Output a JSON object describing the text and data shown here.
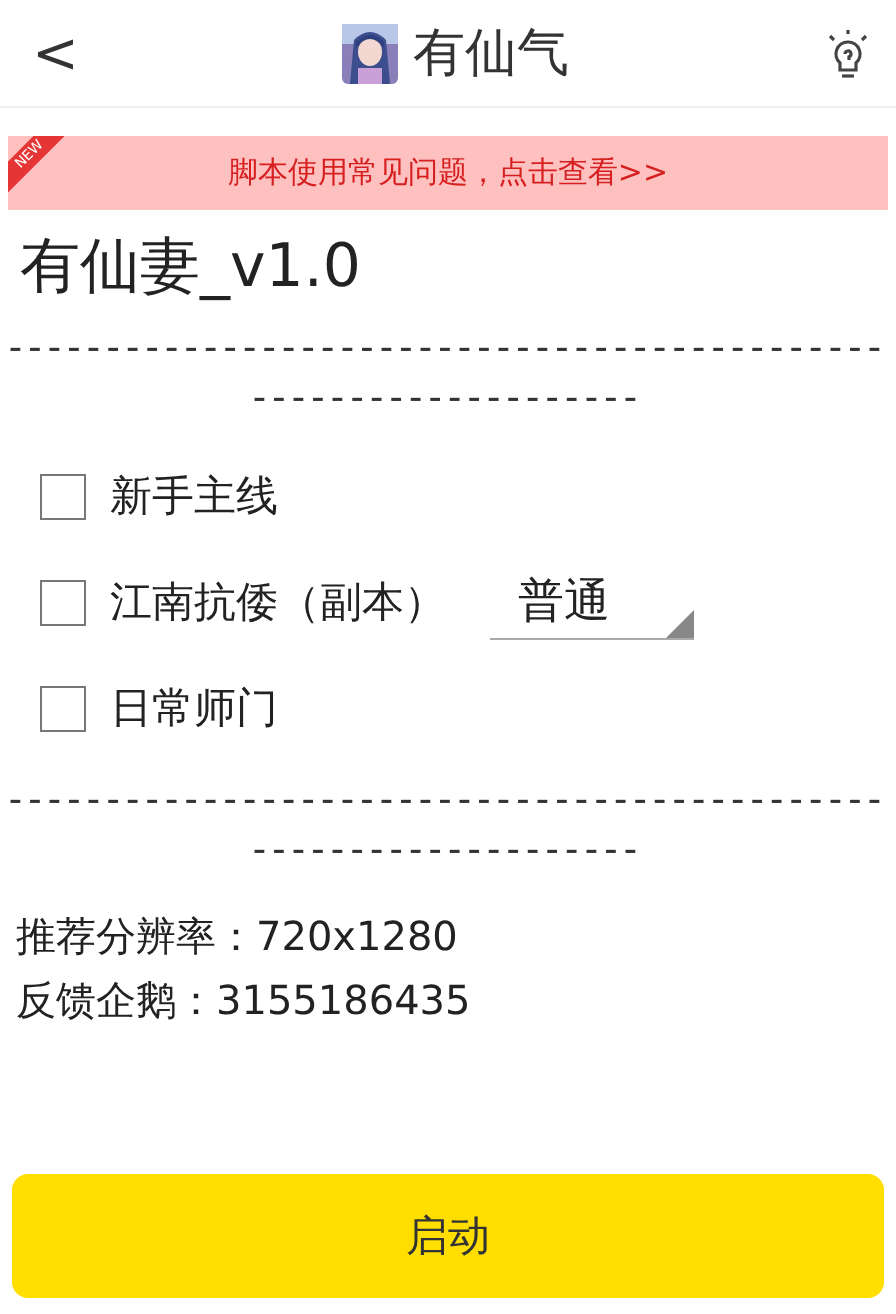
{
  "header": {
    "back": "<",
    "title": "有仙气"
  },
  "banner": {
    "badge": "NEW",
    "text": "脚本使用常见问题，点击查看>>"
  },
  "script_title": "有仙妻_v1.0",
  "separator_top": "-----------------------------------------------------------------",
  "options": [
    {
      "kind": "checkbox",
      "label": "新手主线",
      "checked": false
    },
    {
      "kind": "checkbox_select",
      "label": "江南抗倭（副本）",
      "checked": false,
      "select_value": "普通"
    },
    {
      "kind": "checkbox",
      "label": "日常师门",
      "checked": false
    }
  ],
  "separator_bottom": "-----------------------------------------------------------------",
  "info": [
    "推荐分辨率：720x1280",
    "反馈企鹅：3155186435"
  ],
  "start_button": "启动"
}
